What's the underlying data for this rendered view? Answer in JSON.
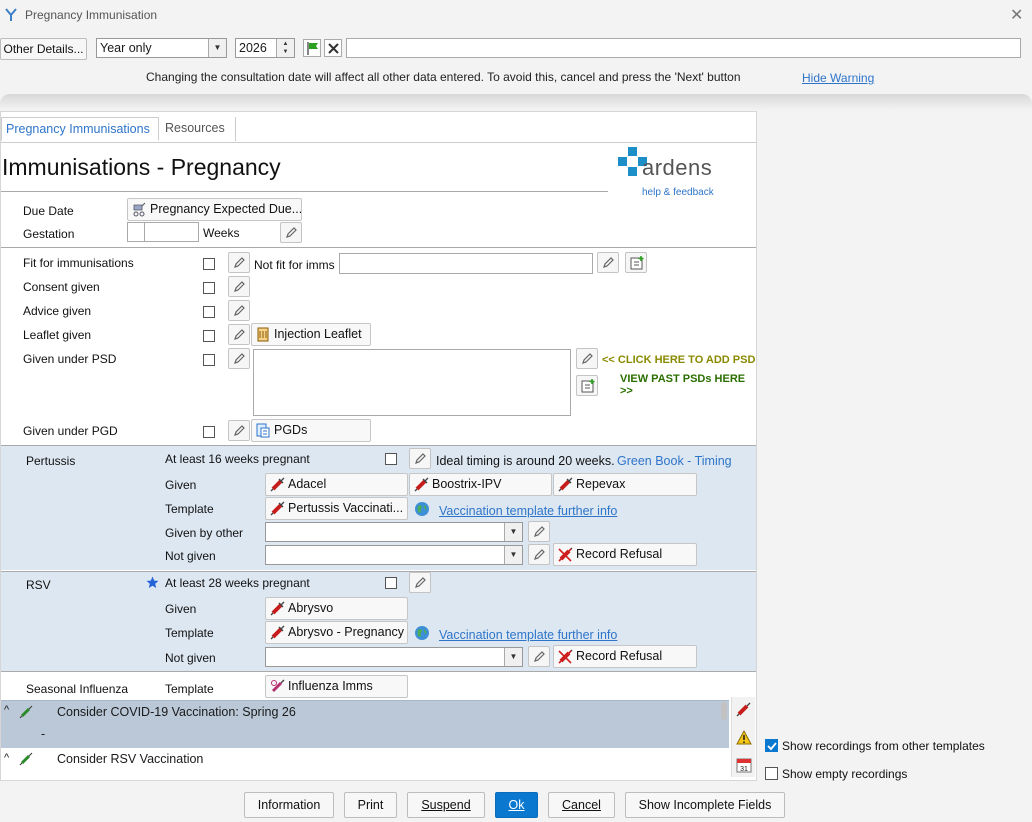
{
  "window": {
    "title": "Pregnancy Immunisation"
  },
  "toolbar": {
    "other_details": "Other Details...",
    "period_value": "Year only",
    "year_value": "2026",
    "search_value": ""
  },
  "warning": {
    "text": "Changing the consultation date will affect all other data entered. To avoid this, cancel and press the 'Next' button",
    "hide": "Hide Warning"
  },
  "tabs": [
    "Pregnancy Immunisations",
    "Resources"
  ],
  "page_title": "Immunisations - Pregnancy",
  "logo": {
    "name": "ardens",
    "tagline": "help & feedback"
  },
  "due": {
    "due_date_label": "Due Date",
    "due_button": "Pregnancy Expected Due...",
    "gestation_label": "Gestation",
    "weeks": "Weeks"
  },
  "checks": {
    "fit": "Fit for immunisations",
    "not_fit": "Not fit for imms",
    "consent": "Consent given",
    "advice": "Advice given",
    "leaflet": "Leaflet given",
    "leaflet_button": "Injection Leaflet",
    "psd": "Given under PSD",
    "add_psd": "<< CLICK HERE TO ADD PSD",
    "past_psd": "VIEW PAST PSDs HERE >>",
    "pgd": "Given under PGD",
    "pgd_button": "PGDs"
  },
  "pertussis": {
    "label": "Pertussis",
    "weeks_req": "At least 16 weeks pregnant",
    "timing": "Ideal timing is around 20 weeks.",
    "timing_link": "Green Book - Timing",
    "given": "Given",
    "vaccines": [
      "Adacel",
      "Boostrix-IPV",
      "Repevax"
    ],
    "template": "Template",
    "template_button": "Pertussis Vaccinati...",
    "template_link": "Vaccination template further info",
    "given_by_other": "Given by other",
    "not_given": "Not given",
    "refusal": "Record Refusal"
  },
  "rsv": {
    "label": "RSV",
    "weeks_req": "At least 28 weeks pregnant",
    "given": "Given",
    "vaccine": "Abrysvo",
    "template": "Template",
    "template_button": "Abrysvo - Pregnancy",
    "template_link": "Vaccination template further info",
    "not_given": "Not given",
    "refusal": "Record Refusal"
  },
  "influenza": {
    "label": "Seasonal Influenza",
    "template": "Template",
    "template_button": "Influenza Imms"
  },
  "suggestions": [
    {
      "title": "Consider COVID-19 Vaccination: Spring 26",
      "detail": "-"
    },
    {
      "title": "Consider RSV Vaccination",
      "detail": ""
    }
  ],
  "options": {
    "show_other": "Show recordings from other templates",
    "show_empty": "Show empty recordings"
  },
  "footer": {
    "information": "Information",
    "print": "Print",
    "suspend": "Suspend",
    "ok": "Ok",
    "cancel": "Cancel",
    "incomplete": "Show Incomplete Fields"
  },
  "colors": {
    "accent": "#2e75c9",
    "band": "#dde7f2",
    "psd_add": "#8a8a00",
    "psd_past": "#2b6e00"
  }
}
